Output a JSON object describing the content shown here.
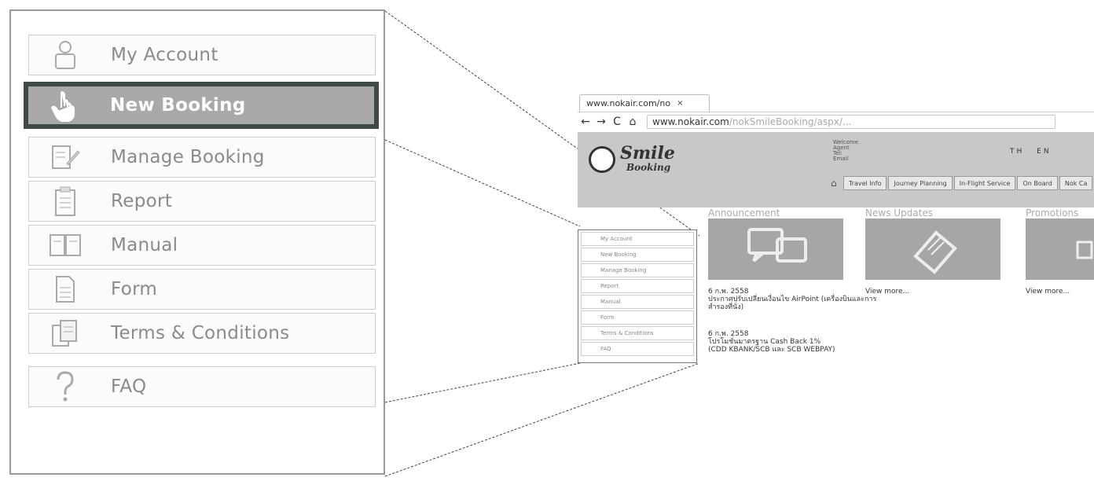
{
  "zoom_menu": {
    "items": [
      {
        "label": "My Account",
        "icon": "user-icon"
      },
      {
        "label": "New Booking",
        "icon": "pointer-hand-icon",
        "active": true
      },
      {
        "label": "Manage Booking",
        "icon": "edit-document-icon"
      },
      {
        "label": "Report",
        "icon": "clipboard-icon"
      },
      {
        "label": "Manual",
        "icon": "book-icon"
      },
      {
        "label": "Form",
        "icon": "document-icon"
      },
      {
        "label": "Terms & Conditions",
        "icon": "documents-icon"
      },
      {
        "label": "FAQ",
        "icon": "question-icon"
      }
    ]
  },
  "browser": {
    "tab_title": "www.nokair.com/no",
    "tab_close": "×",
    "nav": {
      "back": "←",
      "forward": "→",
      "reload": "C",
      "home": "⌂"
    },
    "url_host": "www.nokair.com",
    "url_path": "/nokSmileBooking/aspx/..."
  },
  "site": {
    "logo_main": "Smile",
    "logo_sub": "Booking",
    "welcome_lines": [
      "Welcome",
      "Agent",
      "Tel:",
      "Email"
    ],
    "lang_th": "TH",
    "lang_en": "EN",
    "topnav": [
      "Travel Info",
      "Journey Planning",
      "In-Flight Service",
      "On Board",
      "Nok Ca"
    ],
    "sidebar_items": [
      "My Account",
      "New Booking",
      "Manage Booking",
      "Report",
      "Manual",
      "Form",
      "Terms & Conditions",
      "FAQ"
    ],
    "announcement": {
      "title": "Announcement",
      "news1_date": "6 ก.พ. 2558",
      "news1_text": "ประกาศปรับเปลี่ยนเงื่อนไข AirPoint (เครื่องบินและการสำรองที่นั่ง)",
      "news2_date": "6 ก.พ. 2558",
      "news2_line1": "โปรโมชั่นมาตรฐาน Cash Back 1%",
      "news2_line2": "(CDD KBANK/SCB และ SCB WEBPAY)"
    },
    "news": {
      "title": "News Updates",
      "link": "View more..."
    },
    "promotions": {
      "title": "Promotions",
      "link": "View more..."
    }
  }
}
